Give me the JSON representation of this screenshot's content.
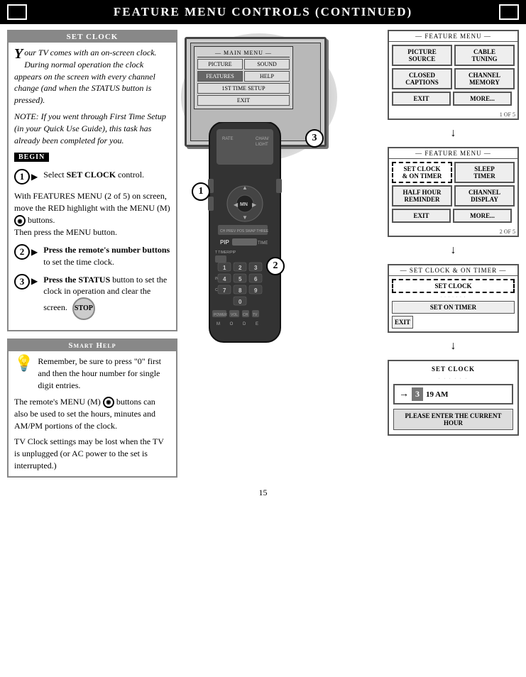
{
  "header": {
    "title": "Feature Menu Controls (Continued)",
    "box_label": ""
  },
  "set_clock": {
    "title": "Set Clock",
    "intro": "Your TV comes with an on-screen clock. During normal operation the clock appears on the screen with every channel change (and when the STATUS button is pressed).",
    "note": "NOTE: If you went through First Time Setup (in your Quick Use Guide), this task has already been completed for you.",
    "begin_label": "BEGIN",
    "step1_label": "Select SET CLOCK control.",
    "step2_label": "Press the remote's number buttons to set the time clock.",
    "step3_label": "Press the STATUS button to set the clock in operation and clear the screen.",
    "step3_button": "STOP"
  },
  "smart_help": {
    "title": "Smart Help",
    "para1": "Remember, be sure to press \"0\" first and then the hour number for single digit entries.",
    "para2": "The remote's MENU (M) buttons can also be used to set the hours, minutes and AM/PM portions of the clock.",
    "para3": "TV Clock settings may be lost when the TV is unplugged (or AC power to the set is interrupted.)"
  },
  "main_menu": {
    "title": "MAIN MENU",
    "buttons": [
      {
        "label": "PICTURE",
        "selected": false
      },
      {
        "label": "SOUND",
        "selected": false
      },
      {
        "label": "FEATURES",
        "selected": true
      },
      {
        "label": "HELP",
        "selected": false
      },
      {
        "label": "1ST TIME SETUP",
        "selected": false
      },
      {
        "label": "EXIT",
        "selected": false
      }
    ]
  },
  "feature_menu_1": {
    "title": "FEATURE MENU",
    "buttons": [
      {
        "label": "PICTURE\nSOURCE"
      },
      {
        "label": "CABLE\nTUNING"
      },
      {
        "label": "CLOSED\nCAPTIONS"
      },
      {
        "label": "CHANNEL\nMEMORY"
      },
      {
        "label": "EXIT"
      },
      {
        "label": "MORE..."
      }
    ],
    "page": "1 OF 5"
  },
  "feature_menu_2": {
    "title": "FEATURE MENU",
    "buttons": [
      {
        "label": "SET CLOCK\n& ON TIMER",
        "selected": true
      },
      {
        "label": "SLEEP\nTIMER"
      },
      {
        "label": "HALF HOUR\nREMINDER"
      },
      {
        "label": "CHANNEL\nDISPLAY"
      },
      {
        "label": "EXIT"
      },
      {
        "label": "MORE..."
      }
    ],
    "page": "2 OF 5"
  },
  "set_clock_on_timer": {
    "title": "SET CLOCK & ON TIMER",
    "btn1": "SET CLOCK",
    "btn2": "SET ON TIMER",
    "btn3": "EXIT"
  },
  "clock_input": {
    "title": "SET CLOCK",
    "display_num": "3",
    "display_time": "19 AM",
    "prompt": "PLEASE ENTER THE CURRENT HOUR"
  },
  "page_number": "15",
  "diagram_numbers": [
    "1",
    "2",
    "3"
  ],
  "step_indicators": {
    "step1": "1 ▶",
    "step2": "2 ▶",
    "step3": "3 ▶"
  }
}
